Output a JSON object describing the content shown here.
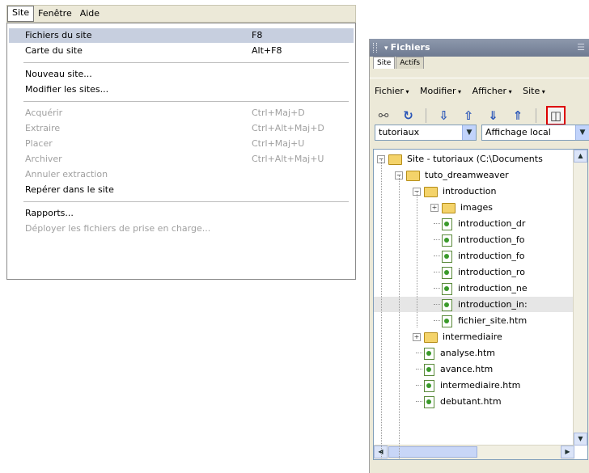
{
  "menubar": {
    "items": [
      "Site",
      "Fenêtre",
      "Aide"
    ]
  },
  "dropdown": {
    "groups": [
      [
        {
          "label": "Fichiers du site",
          "shortcut": "F8",
          "highlighted": true,
          "disabled": false
        },
        {
          "label": "Carte du site",
          "shortcut": "Alt+F8",
          "disabled": false
        }
      ],
      [
        {
          "label": "Nouveau site...",
          "shortcut": "",
          "disabled": false
        },
        {
          "label": "Modifier les sites...",
          "shortcut": "",
          "disabled": false
        }
      ],
      [
        {
          "label": "Acquérir",
          "shortcut": "Ctrl+Maj+D",
          "disabled": true
        },
        {
          "label": "Extraire",
          "shortcut": "Ctrl+Alt+Maj+D",
          "disabled": true
        },
        {
          "label": "Placer",
          "shortcut": "Ctrl+Maj+U",
          "disabled": true
        },
        {
          "label": "Archiver",
          "shortcut": "Ctrl+Alt+Maj+U",
          "disabled": true
        },
        {
          "label": "Annuler extraction",
          "shortcut": "",
          "disabled": true
        },
        {
          "label": "Repérer dans le site",
          "shortcut": "",
          "disabled": false
        }
      ],
      [
        {
          "label": "Rapports...",
          "shortcut": "",
          "disabled": false
        },
        {
          "label": "Déployer les fichiers de prise en charge...",
          "shortcut": "",
          "disabled": true
        }
      ]
    ]
  },
  "panel": {
    "title": "Fichiers",
    "options_glyph": "☰",
    "tabs": [
      "Site",
      "Actifs"
    ],
    "menus": [
      "Fichier",
      "Modifier",
      "Afficher",
      "Site"
    ],
    "toolbar_icons": [
      "connect-icon",
      "refresh-icon",
      "get-icon",
      "put-icon",
      "checkout-icon",
      "checkin-icon",
      "expand-icon"
    ],
    "site_select": "tutoriaux",
    "view_select": "Affichage local",
    "tree": [
      {
        "label": "Site - tutoriaux (C:\\Documents",
        "type": "folder",
        "level": 0,
        "toggle": "−"
      },
      {
        "label": "tuto_dreamweaver",
        "type": "folder",
        "level": 1,
        "toggle": "−"
      },
      {
        "label": "introduction",
        "type": "folder",
        "level": 2,
        "toggle": "−"
      },
      {
        "label": "images",
        "type": "folder",
        "level": 3,
        "toggle": "+"
      },
      {
        "label": "introduction_dr",
        "type": "file",
        "level": 3
      },
      {
        "label": "introduction_fo",
        "type": "file",
        "level": 3
      },
      {
        "label": "introduction_fo",
        "type": "file",
        "level": 3
      },
      {
        "label": "introduction_ro",
        "type": "file",
        "level": 3
      },
      {
        "label": "introduction_ne",
        "type": "file",
        "level": 3
      },
      {
        "label": "introduction_in:",
        "type": "file",
        "level": 3,
        "highlighted": true
      },
      {
        "label": "fichier_site.htm",
        "type": "file",
        "level": 3
      },
      {
        "label": "intermediaire",
        "type": "folder",
        "level": 2,
        "toggle": "+"
      },
      {
        "label": "analyse.htm",
        "type": "file",
        "level": 2
      },
      {
        "label": "avance.htm",
        "type": "file",
        "level": 2
      },
      {
        "label": "intermediaire.htm",
        "type": "file",
        "level": 2
      },
      {
        "label": "debutant.htm",
        "type": "file",
        "level": 2
      }
    ]
  }
}
